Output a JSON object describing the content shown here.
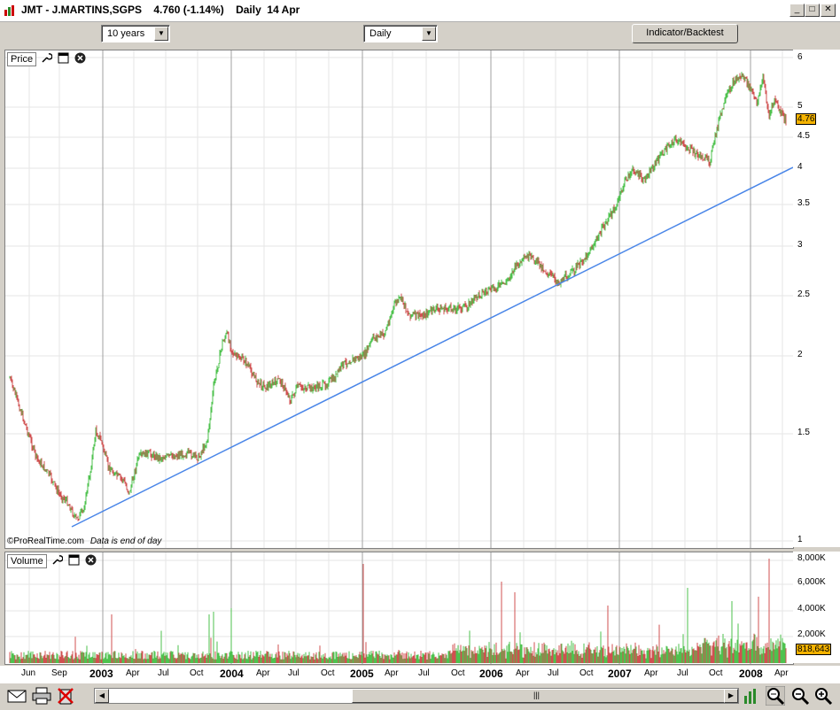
{
  "window": {
    "title": "JMT - J.MARTINS,SGPS    4.760 (-1.14%)    Daily  14 Apr"
  },
  "toolbar": {
    "period_value": "10 years",
    "interval_value": "Daily",
    "indicator_button": "Indicator/Backtest"
  },
  "price_panel": {
    "label": "Price",
    "copyright": "©ProRealTime.com",
    "note": "Data is end of day",
    "current_price": "4.76",
    "y_ticks": [
      "6",
      "5",
      "4.5",
      "4",
      "3.5",
      "3",
      "2.5",
      "2",
      "1.5",
      "1"
    ]
  },
  "volume_panel": {
    "label": "Volume",
    "current_volume": "818,643",
    "y_ticks": [
      "8,000K",
      "6,000K",
      "4,000K",
      "2,000K"
    ]
  },
  "date_axis": [
    "Jun",
    "Sep",
    "2003",
    "Apr",
    "Jul",
    "Oct",
    "2004",
    "Apr",
    "Jul",
    "Oct",
    "2005",
    "Apr",
    "Jul",
    "Oct",
    "2006",
    "Apr",
    "Jul",
    "Oct",
    "2007",
    "Apr",
    "Jul",
    "Oct",
    "2008",
    "Apr"
  ],
  "colors": {
    "up": "#4ec24e",
    "down": "#d05050",
    "trendline": "#4a86e8",
    "badge": "#f5b300"
  },
  "icons": [
    "wrench-icon",
    "window-icon",
    "close-icon",
    "mail-icon",
    "print-icon",
    "delete-icon",
    "chart-icon",
    "zoom-fit-icon",
    "zoom-out-icon",
    "zoom-in-icon"
  ]
}
